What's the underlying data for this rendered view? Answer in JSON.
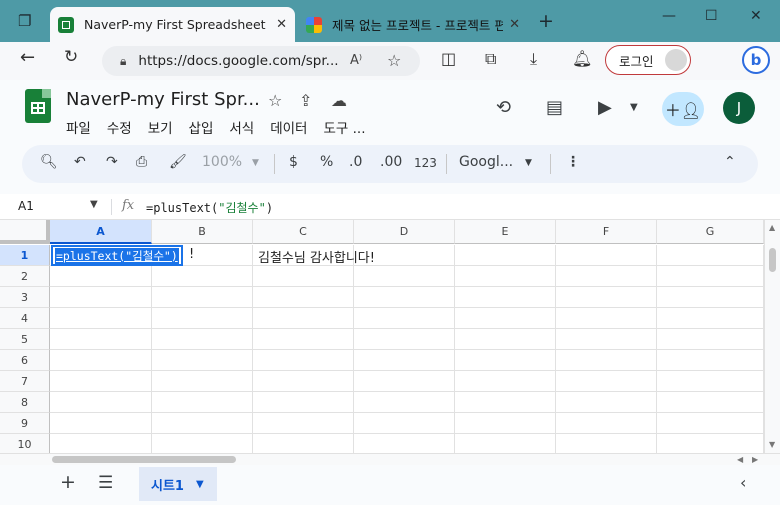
{
  "browser": {
    "active_tab_title": "NaverP-my First Spreadsheet - G",
    "inactive_tab_title": "제목 없는 프로젝트 - 프로젝트 편",
    "url": "https://docs.google.com/spr...",
    "login_label": "로그인",
    "bing_label": "b"
  },
  "doc": {
    "title": "NaverP-my First Spr...",
    "menu": [
      "파일",
      "수정",
      "보기",
      "삽입",
      "서식",
      "데이터",
      "도구 ..."
    ],
    "user_initial": "J"
  },
  "toolbar": {
    "zoom": "100%",
    "currency": "$",
    "percent": "%",
    "dec_decrease": ".0",
    "dec_increase": ".00",
    "number_format": "123",
    "font": "Googl..."
  },
  "formula_bar": {
    "cell_ref": "A1",
    "fx": "fx",
    "formula_prefix": "=plusText(",
    "formula_string": "\"김철수\"",
    "formula_suffix": ")"
  },
  "grid": {
    "columns": [
      "A",
      "B",
      "C",
      "D",
      "E",
      "F",
      "G"
    ],
    "rows": [
      "1",
      "2",
      "3",
      "4",
      "5",
      "6",
      "7",
      "8",
      "9",
      "10"
    ],
    "a1_editing": "=plusText(\"김철수\")",
    "b1_text": "!",
    "c1_text": "김철수님 감사합니다!"
  },
  "sheets": {
    "active_sheet": "시트1"
  }
}
